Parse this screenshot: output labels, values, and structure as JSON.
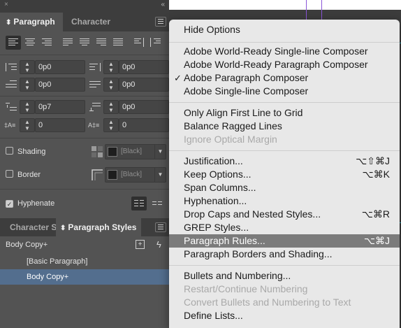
{
  "colors": {
    "panel_bg": "#535353",
    "menu_bg": "#e8e8e8",
    "menu_highlight": "#7b7b7b",
    "selected_style": "#536e8e",
    "guide_purple": "#8a55d8",
    "guide_teal": "#2aa8b8"
  },
  "panel": {
    "collapse_icon": "«",
    "close_icon": "×",
    "tabs": [
      {
        "label": "Paragraph",
        "active": true,
        "arrows": "⬍"
      },
      {
        "label": "Character",
        "active": false
      }
    ],
    "alignment_buttons": [
      "align-left",
      "align-center",
      "align-right",
      "justify-left",
      "justify-center",
      "justify-right",
      "justify-all",
      "align-towards-spine",
      "align-away-from-spine"
    ],
    "fields": {
      "left_indent": "0p0",
      "right_indent": "0p0",
      "first_line_indent": "0p0",
      "last_line_indent": "0p0",
      "space_before": "0p7",
      "space_after": "0p0",
      "drop_cap_lines": "0",
      "drop_cap_chars": "0"
    },
    "shading": {
      "label": "Shading",
      "swatch": "[Black]",
      "checked": false
    },
    "border": {
      "label": "Border",
      "swatch": "[Black]",
      "checked": false
    },
    "hyphenate": {
      "label": "Hyphenate",
      "checked": true
    },
    "bottom_tabs": [
      {
        "label": "Character S",
        "active": false
      },
      {
        "label": "Paragraph Styles",
        "active": true,
        "arrows": "⬍"
      }
    ],
    "current_style": "Body Copy+",
    "styles": [
      {
        "label": "[Basic Paragraph]",
        "selected": false
      },
      {
        "label": "Body Copy+",
        "selected": true
      }
    ]
  },
  "menu": {
    "hide_options": "Hide Options",
    "composers": [
      {
        "label": "Adobe World-Ready Single-line Composer",
        "checked": false
      },
      {
        "label": "Adobe World-Ready Paragraph Composer",
        "checked": false
      },
      {
        "label": "Adobe Paragraph Composer",
        "checked": true
      },
      {
        "label": "Adobe Single-line Composer",
        "checked": false
      }
    ],
    "check_mark": "✓",
    "grid": [
      {
        "label": "Only Align First Line to Grid",
        "disabled": false
      },
      {
        "label": "Balance Ragged Lines",
        "disabled": false
      },
      {
        "label": "Ignore Optical Margin",
        "disabled": true
      }
    ],
    "commands": [
      {
        "label": "Justification...",
        "shortcut": "⌥⇧⌘J"
      },
      {
        "label": "Keep Options...",
        "shortcut": "⌥⌘K"
      },
      {
        "label": "Span Columns...",
        "shortcut": ""
      },
      {
        "label": "Hyphenation...",
        "shortcut": ""
      },
      {
        "label": "Drop Caps and Nested Styles...",
        "shortcut": "⌥⌘R"
      },
      {
        "label": "GREP Styles...",
        "shortcut": ""
      },
      {
        "label": "Paragraph Rules...",
        "shortcut": "⌥⌘J",
        "highlighted": true
      },
      {
        "label": "Paragraph Borders and Shading...",
        "shortcut": ""
      }
    ],
    "lists": [
      {
        "label": "Bullets and Numbering...",
        "disabled": false
      },
      {
        "label": "Restart/Continue Numbering",
        "disabled": true
      },
      {
        "label": "Convert Bullets and Numbering to Text",
        "disabled": true
      },
      {
        "label": "Define Lists...",
        "disabled": false
      }
    ]
  }
}
